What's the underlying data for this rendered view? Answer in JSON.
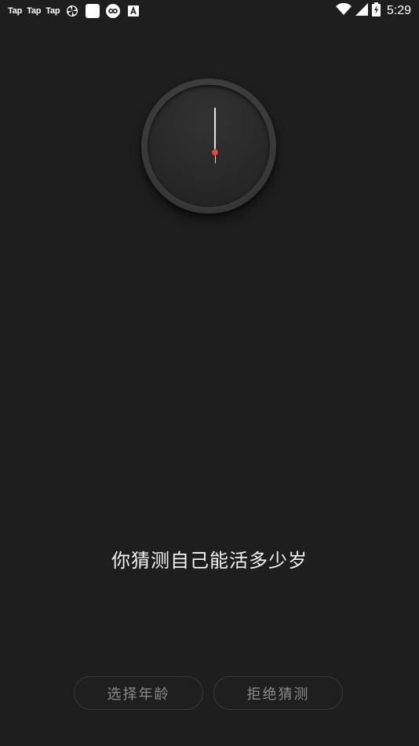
{
  "status_bar": {
    "notifications": [
      "Tap",
      "Tap",
      "Tap"
    ],
    "icons": [
      "pinwheel-icon",
      "white-square-icon",
      "infinity-circle-icon",
      "letter-a-icon"
    ],
    "right_icons": [
      "wifi-icon",
      "signal-icon",
      "battery-icon"
    ],
    "time": "5:29"
  },
  "clock": {
    "icon": "analog-clock-icon",
    "center_color": "#e04a3a"
  },
  "main": {
    "question": "你猜测自己能活多少岁"
  },
  "buttons": {
    "choose_age": "选择年龄",
    "refuse_guess": "拒绝猜测"
  },
  "colors": {
    "background": "#1e1e1e",
    "button_text": "#8a8a8a",
    "button_border": "#3a3a3a"
  }
}
